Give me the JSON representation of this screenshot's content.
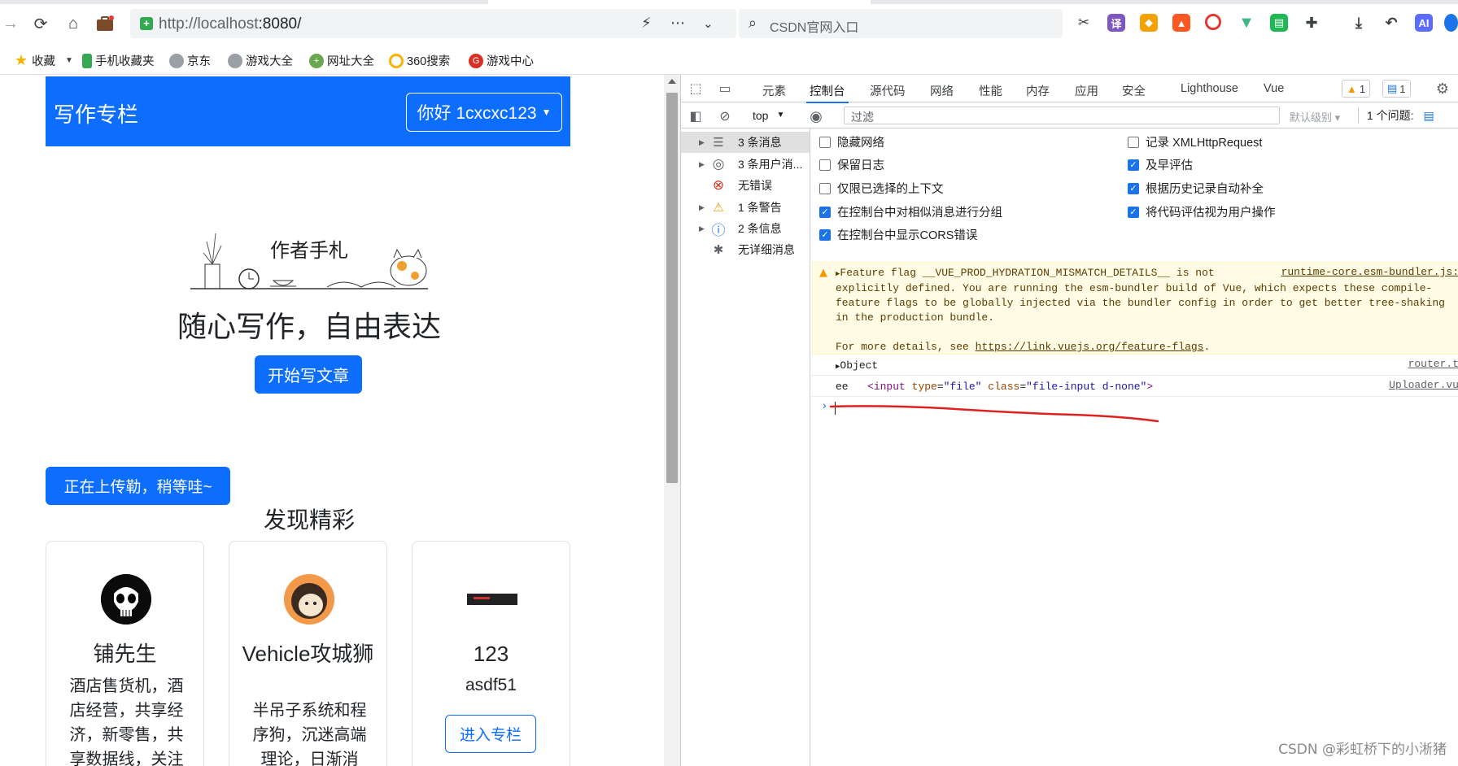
{
  "browser": {
    "url_host": "http://localhost",
    "url_port": ":8080/",
    "search_placeholder": "CSDN官网入口"
  },
  "bookmarks": [
    {
      "label": "收藏",
      "icon": "star-icon",
      "color": "#f6b400"
    },
    {
      "label": "手机收藏夹",
      "icon": "phone-icon",
      "color": "#34a853"
    },
    {
      "label": "京东",
      "icon": "globe-icon",
      "color": "#9aa0a6"
    },
    {
      "label": "游戏大全",
      "icon": "globe-icon",
      "color": "#9aa0a6"
    },
    {
      "label": "网址大全",
      "icon": "plus-circle-icon",
      "color": "#6aa84f"
    },
    {
      "label": "360搜索",
      "icon": "360-icon",
      "color": "#f6b400"
    },
    {
      "label": "游戏中心",
      "icon": "game-icon",
      "color": "#d93025"
    }
  ],
  "page": {
    "header_title": "写作专栏",
    "greeting_button": "你好 1cxcxc123",
    "hero_logo_text": "作者手札",
    "hero_text": "随心写作，自由表达",
    "start_button": "开始写文章",
    "upload_button": "正在上传勒，稍等哇~",
    "discover_title": "发现精彩",
    "cards": [
      {
        "name": "铺先生",
        "desc": "酒店售货机，酒店经营，共享经济，新零售，共享数据线，关注"
      },
      {
        "name": "Vehicle攻城狮",
        "desc": "半吊子系统和程序狗，沉迷高端理论，日渐消"
      },
      {
        "name": "123",
        "sub": "asdf51",
        "button": "进入专栏"
      }
    ]
  },
  "devtools": {
    "tabs": [
      "元素",
      "控制台",
      "源代码",
      "网络",
      "性能",
      "内存",
      "应用",
      "安全",
      "Lighthouse",
      "Vue"
    ],
    "active_tab": "控制台",
    "warning_count": "1",
    "message_count": "1",
    "context": "top",
    "filter_placeholder": "过滤",
    "level": "默认级别",
    "issues": "1 个问题:",
    "sidebar": [
      {
        "label": "3 条消息",
        "icon": "list-icon",
        "expandable": true
      },
      {
        "label": "3 条用户消...",
        "icon": "user-icon",
        "expandable": true
      },
      {
        "label": "无错误",
        "icon": "error-icon",
        "expandable": false
      },
      {
        "label": "1 条警告",
        "icon": "warning-icon",
        "expandable": true
      },
      {
        "label": "2 条信息",
        "icon": "info-icon",
        "expandable": true
      },
      {
        "label": "无详细消息",
        "icon": "bug-icon",
        "expandable": false
      }
    ],
    "settings_left": [
      {
        "label": "隐藏网络",
        "checked": false
      },
      {
        "label": "保留日志",
        "checked": false
      },
      {
        "label": "仅限已选择的上下文",
        "checked": false
      },
      {
        "label": "在控制台中对相似消息进行分组",
        "checked": true
      },
      {
        "label": "在控制台中显示CORS错误",
        "checked": true
      }
    ],
    "settings_right": [
      {
        "label": "记录 XMLHttpRequest",
        "checked": false
      },
      {
        "label": "及早评估",
        "checked": true
      },
      {
        "label": "根据历史记录自动补全",
        "checked": true
      },
      {
        "label": "将代码评估视为用户操作",
        "checked": true
      }
    ],
    "warning": {
      "line1": "Feature flag __VUE_PROD_HYDRATION_MISMATCH_DETAILS__ is not",
      "line2": "explicitly defined. You are running the esm-bundler build of Vue, which expects these compile-",
      "line3": "feature flags to be globally injected via the bundler config in order to get better tree-shaking",
      "line4": "in the production bundle.",
      "more_prefix": "For more details, see ",
      "more_link": "https://link.vuejs.org/feature-flags",
      "more_suffix": ".",
      "source": "runtime-core.esm-bundler.js:"
    },
    "log_object": {
      "text": "Object",
      "source": "router.t"
    },
    "log_input": {
      "prefix": "ee",
      "tag_open": "<input",
      "attr1": "type",
      "val1": "\"file\"",
      "attr2": "class",
      "val2": "\"file-input d-none\"",
      "tag_close": ">",
      "source": "Uploader.vu"
    }
  },
  "watermark": "CSDN @彩虹桥下的小淅猪"
}
